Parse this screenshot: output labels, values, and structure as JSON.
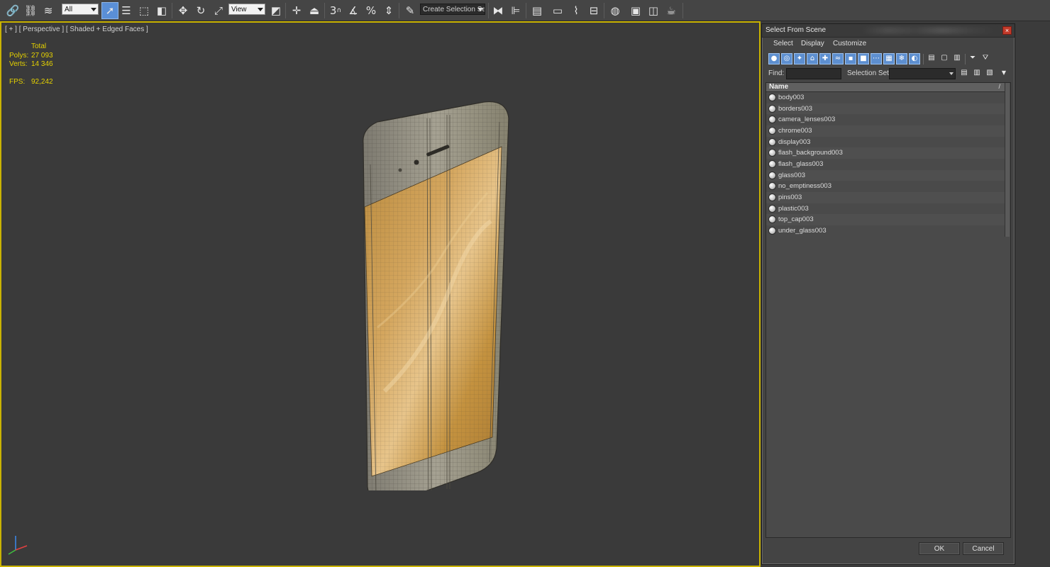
{
  "toolbar": {
    "selection_filter": "All",
    "coord_system": "View",
    "snap_toggle": "3",
    "named_selection": "Create Selection Se"
  },
  "viewport": {
    "label": "[ + ] [ Perspective ] [ Shaded + Edged Faces ]",
    "stats": {
      "total_label": "Total",
      "polys_label": "Polys:",
      "polys_value": "27 093",
      "verts_label": "Verts:",
      "verts_value": "14 346",
      "fps_label": "FPS:",
      "fps_value": "92,242"
    }
  },
  "dialog": {
    "title": "Select From Scene",
    "close_glyph": "×",
    "menu": [
      "Select",
      "Display",
      "Customize"
    ],
    "find_label": "Find:",
    "find_value": "",
    "selection_set_label": "Selection Set:",
    "selection_set_value": "",
    "column_header": "Name",
    "sort_indicator": "/",
    "objects": [
      "body003",
      "borders003",
      "camera_lenses003",
      "chrome003",
      "display003",
      "flash_background003",
      "flash_glass003",
      "glass003",
      "no_emptiness003",
      "pins003",
      "plastic003",
      "top_cap003",
      "under_glass003"
    ],
    "ok_label": "OK",
    "cancel_label": "Cancel"
  },
  "colors": {
    "viewport_border": "#c9b300",
    "stats_text": "#e6d200",
    "accent": "#5a8fd6",
    "close_button": "#c23a2a"
  }
}
